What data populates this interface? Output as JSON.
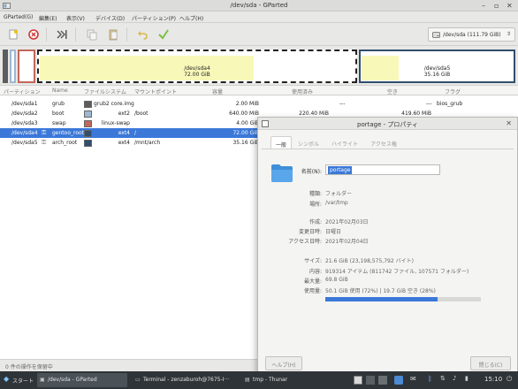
{
  "window": {
    "title": "/dev/sda - GParted",
    "minimize": "–",
    "maximize": "▫",
    "close": "✕"
  },
  "menu": [
    "GParted(G)",
    "編集(E)",
    "表示(V)",
    "デバイス(D)",
    "パーティション(P)",
    "ヘルプ(H)"
  ],
  "toolbar": {
    "icons": [
      "new-partition-icon",
      "delete-icon",
      "resize-move-icon",
      "copy-icon",
      "paste-icon",
      "undo-icon",
      "apply-icon"
    ],
    "device_label": "/dev/sda (111.79 GiB)",
    "device_chevron": "⇕"
  },
  "diskmap": {
    "sda4_name": "/dev/sda4",
    "sda4_size": "72.00 GiB",
    "sda5_name": "/dev/sda5",
    "sda5_size": "35.16 GiB"
  },
  "columns": [
    "パーティション",
    "Name",
    "ファイルシステム",
    "マウントポイント",
    "容量",
    "使用済み",
    "空き",
    "フラグ"
  ],
  "partitions": [
    {
      "partition": "/dev/sda1",
      "name": "grub",
      "fs": "grub2 core.img",
      "mount": "",
      "size": "2.00 MiB",
      "used": "---",
      "free": "---",
      "flags": "bios_grub",
      "color": "#5d5d5d"
    },
    {
      "partition": "/dev/sda2",
      "name": "boot",
      "fs": "ext2",
      "mount": "/boot",
      "size": "640.00 MiB",
      "used": "220.40 MiB",
      "free": "419.60 MiB",
      "flags": "",
      "color": "#9db8d2"
    },
    {
      "partition": "/dev/sda3",
      "name": "swap",
      "fs": "linux-swap",
      "mount": "",
      "size": "4.00 GiB",
      "used": "",
      "free": "",
      "flags": "",
      "color": "#c1665a"
    },
    {
      "partition": "/dev/sda4",
      "name": "gentoo_root",
      "fs": "ext4",
      "mount": "/",
      "size": "72.00 GiB",
      "used": "",
      "free": "",
      "flags": "",
      "color": "#314e6c"
    },
    {
      "partition": "/dev/sda5",
      "name": "arch_root",
      "fs": "ext4",
      "mount": "/mnt/arch",
      "size": "35.16 GiB",
      "used": "",
      "free": "",
      "flags": "",
      "color": "#314e6c"
    }
  ],
  "status": "0 件の操作を保留中",
  "dialog": {
    "title": "portage - プロパティ",
    "close": "✕",
    "tabs": [
      "一般",
      "シンボル",
      "ハイライト",
      "アクセス権"
    ],
    "name_label": "名前(N):",
    "name_value": "portage",
    "kind_label": "種類:",
    "kind_value": "フォルダー",
    "location_label": "場所:",
    "location_value": "/var/tmp",
    "created_label": "作成:",
    "created_value": "2021年02月03日",
    "modified_label": "変更日時:",
    "modified_value": "日曜日",
    "accessed_label": "アクセス日時:",
    "accessed_value": "2021年02月04日",
    "size_label": "サイズ:",
    "size_value": "21.6 GiB (23,198,575,792 バイト)",
    "contents_label": "内容:",
    "contents_value": "919314 アイテム (811742 ファイル, 107571 フォルダー)",
    "capacity_label": "最大量:",
    "capacity_value": "69.8 GiB",
    "usage_label": "使用量:",
    "usage_value": "50.1 GiB 使用 (72%)  |  19.7 GiB 空き (28%)",
    "usage_percent": 72,
    "help_button": "ヘルプ(H)",
    "close_button": "閉じる(C)"
  },
  "taskbar": {
    "start": "スタート",
    "tasks": [
      "/dev/sda - GParted",
      "Terminal - zenzaburoh@7675-I···",
      "tmp - Thunar"
    ],
    "clock": "15:10"
  }
}
